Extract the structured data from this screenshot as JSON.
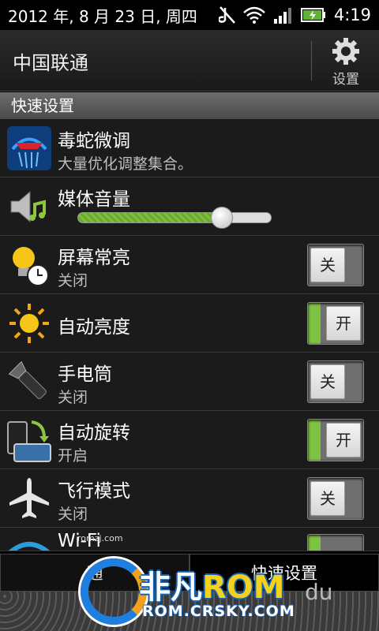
{
  "status_bar": {
    "date": "2012 年, 8 月 23 日, 周四",
    "time": "4:19",
    "icons": [
      "no-sound-icon",
      "wifi-icon",
      "signal-icon",
      "battery-charging-icon"
    ]
  },
  "header": {
    "carrier": "中国联通",
    "settings_label": "设置"
  },
  "section_title": "快速设置",
  "items": [
    {
      "title": "毒蛇微调",
      "subtitle": "大量优化调整集合。",
      "icon": "viper-app-icon"
    },
    {
      "title": "媒体音量",
      "icon": "speaker-icon",
      "volume": 0.74
    },
    {
      "title": "屏幕常亮",
      "subtitle": "关闭",
      "icon": "bulb-clock-icon",
      "toggle": "关"
    },
    {
      "title": "自动亮度",
      "icon": "sun-icon",
      "toggle": "开"
    },
    {
      "title": "手电筒",
      "subtitle": "关闭",
      "icon": "flashlight-icon",
      "toggle": "关"
    },
    {
      "title": "自动旋转",
      "subtitle": "开启",
      "icon": "rotate-icon",
      "toggle": "开"
    },
    {
      "title": "飞行模式",
      "subtitle": "关闭",
      "icon": "airplane-icon",
      "toggle": "关"
    },
    {
      "title": "Wi-Fi",
      "icon": "wifi-icon"
    }
  ],
  "tabs": [
    "通",
    "快速设置"
  ],
  "watermark": {
    "small": "romzj.com",
    "brand_cn": "非凡",
    "brand_rom": "ROM",
    "url": "ROM.CRSKY.COM",
    "extra": "du"
  },
  "colors": {
    "toggle_on": "#7fc142",
    "accent_blue": "#1f7fe0"
  }
}
